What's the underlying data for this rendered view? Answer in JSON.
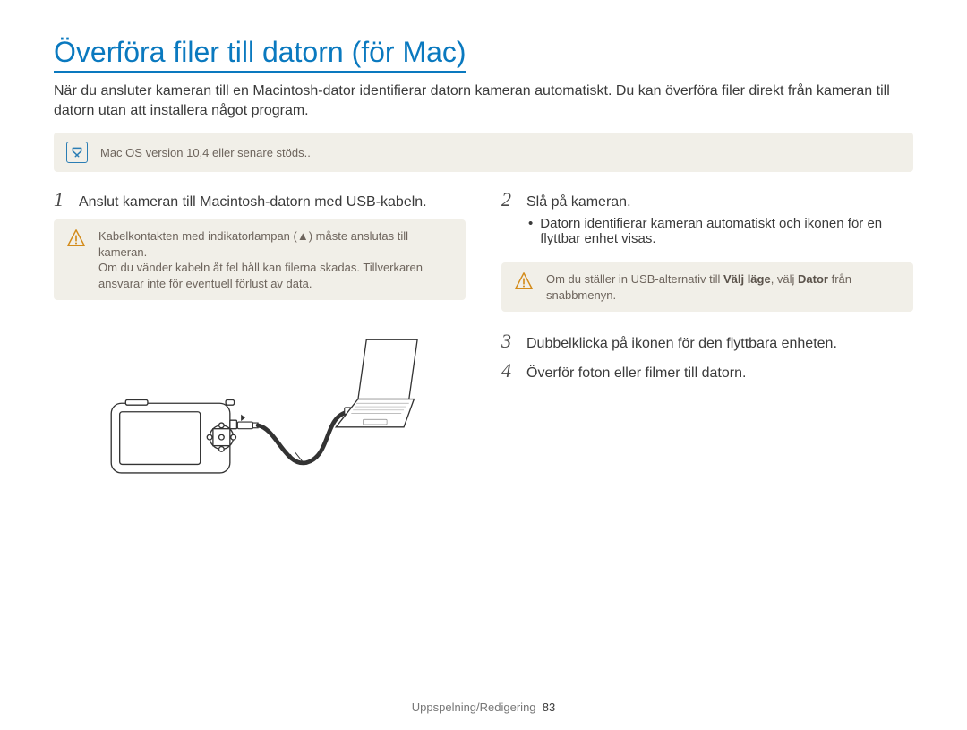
{
  "page_title": "Överföra filer till datorn (för Mac)",
  "intro": "När du ansluter kameran till en Macintosh-dator identifierar datorn kameran automatiskt. Du kan överföra filer direkt från kameran till datorn utan att installera något program.",
  "top_note": "Mac OS version 10,4 eller senare stöds..",
  "left": {
    "step1": "Anslut kameran till Macintosh-datorn med USB-kabeln.",
    "warn_lines": [
      "Kabelkontakten med indikatorlampan (▲) måste anslutas till kameran.",
      "Om du vänder kabeln åt fel håll kan filerna skadas. Tillverkaren ansvarar inte för eventuell förlust av data."
    ]
  },
  "right": {
    "step2": "Slå på kameran.",
    "step2_bullet": "Datorn identifierar kameran automatiskt och ikonen för en flyttbar enhet visas.",
    "warn": {
      "prefix": "Om du ställer in USB-alternativ till ",
      "bold1": "Välj läge",
      "mid": ", välj ",
      "bold2": "Dator",
      "suffix": " från snabbmenyn."
    },
    "step3": "Dubbelklicka på ikonen för den flyttbara enheten.",
    "step4": "Överför foton eller filmer till datorn."
  },
  "footer_label": "Uppspelning/Redigering",
  "footer_page": "83"
}
